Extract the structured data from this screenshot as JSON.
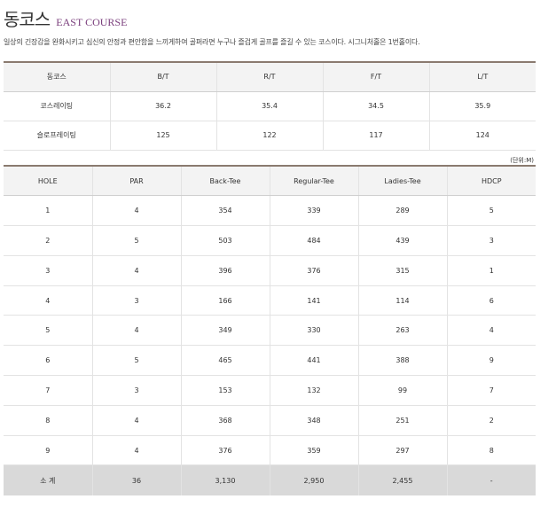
{
  "header": {
    "title_ko": "동코스",
    "title_en": "EAST COURSE",
    "intro": "일상의 긴장감을 완화시키고 심신의 안정과 편안함을 느끼게하여 골퍼라면 누구나 즐겁게 골프를 즐길 수 있는 코스이다. 시그니처홀은 1번홀이다."
  },
  "rating_table": {
    "headers": [
      "동코스",
      "B/T",
      "R/T",
      "F/T",
      "L/T"
    ],
    "rows": [
      [
        "코스레이팅",
        "36.2",
        "35.4",
        "34.5",
        "35.9"
      ],
      [
        "슬로프레이팅",
        "125",
        "122",
        "117",
        "124"
      ]
    ]
  },
  "unit_label": "(단위:M)",
  "hole_table": {
    "headers": [
      "HOLE",
      "PAR",
      "Back-Tee",
      "Regular-Tee",
      "Ladies-Tee",
      "HDCP"
    ],
    "rows": [
      [
        "1",
        "4",
        "354",
        "339",
        "289",
        "5"
      ],
      [
        "2",
        "5",
        "503",
        "484",
        "439",
        "3"
      ],
      [
        "3",
        "4",
        "396",
        "376",
        "315",
        "1"
      ],
      [
        "4",
        "3",
        "166",
        "141",
        "114",
        "6"
      ],
      [
        "5",
        "4",
        "349",
        "330",
        "263",
        "4"
      ],
      [
        "6",
        "5",
        "465",
        "441",
        "388",
        "9"
      ],
      [
        "7",
        "3",
        "153",
        "132",
        "99",
        "7"
      ],
      [
        "8",
        "4",
        "368",
        "348",
        "251",
        "2"
      ],
      [
        "9",
        "4",
        "376",
        "359",
        "297",
        "8"
      ]
    ],
    "total": [
      "소 계",
      "36",
      "3,130",
      "2,950",
      "2,455",
      "-"
    ]
  },
  "colors": {
    "accent": "#7a3e7c",
    "header_bg": "#f3f3f3",
    "total_bg": "#d9d9d9",
    "top_rule": "#8a7a6f"
  }
}
